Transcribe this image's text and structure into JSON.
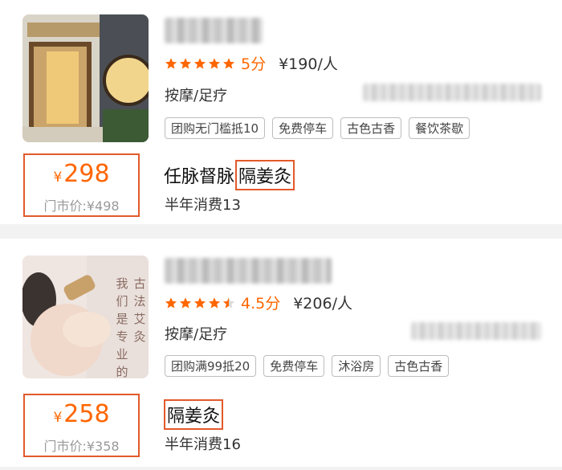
{
  "listings": [
    {
      "stars": [
        1,
        1,
        1,
        1,
        1
      ],
      "rating": "5分",
      "avg_price": "¥190/人",
      "category": "按摩/足疗",
      "tags": [
        "团购无门槛抵10",
        "免费停车",
        "古色古香",
        "餐饮茶歇"
      ],
      "price_yen": "¥",
      "price": "298",
      "original_price": "门市价:¥498",
      "deal_title_prefix": "任脉督脉",
      "deal_title_highlight": "隔姜灸",
      "sales": "半年消费13"
    },
    {
      "stars": [
        1,
        1,
        1,
        1,
        0.5
      ],
      "rating": "4.5分",
      "avg_price": "¥206/人",
      "category": "按摩/足疗",
      "tags": [
        "团购满99抵20",
        "免费停车",
        "沐浴房",
        "古色古香"
      ],
      "image_text": [
        "古",
        "法",
        "艾",
        "灸",
        "我",
        "们",
        "是",
        "专",
        "业",
        "的"
      ],
      "price_yen": "¥",
      "price": "258",
      "original_price": "门市价:¥358",
      "deal_title_prefix": "",
      "deal_title_highlight": "隔姜灸",
      "sales": "半年消费16"
    }
  ],
  "colors": {
    "accent": "#ff6600",
    "highlight_border": "#e25a2b",
    "tag_border": "#bdbdbd"
  }
}
